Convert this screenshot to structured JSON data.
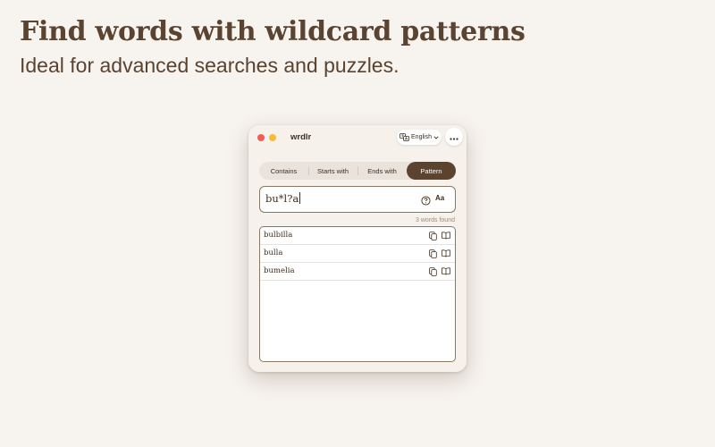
{
  "hero": {
    "title": "Find words with wildcard patterns",
    "subtitle": "Ideal for advanced searches and puzzles."
  },
  "window": {
    "app_title": "wrdlr",
    "language": "English",
    "icons": {
      "language": "translate-icon",
      "language_chevron": "chevron-down-icon",
      "more": "ellipsis-icon"
    }
  },
  "modes": {
    "items": [
      "Contains",
      "Starts with",
      "Ends with",
      "Pattern"
    ],
    "selected": "Pattern"
  },
  "search": {
    "value": "bu*l?a",
    "aa_label": "Aa",
    "icons": {
      "help": "question-circle-icon"
    }
  },
  "results": {
    "count_text": "3 words found",
    "words": [
      "bulbilla",
      "bulla",
      "bumelia"
    ],
    "row_icons": [
      "copy-icon",
      "book-icon"
    ]
  },
  "colors": {
    "background": "#f7f3ee",
    "accent": "#5b4330",
    "close": "#ee5f57",
    "minimize": "#f6bd2f"
  }
}
